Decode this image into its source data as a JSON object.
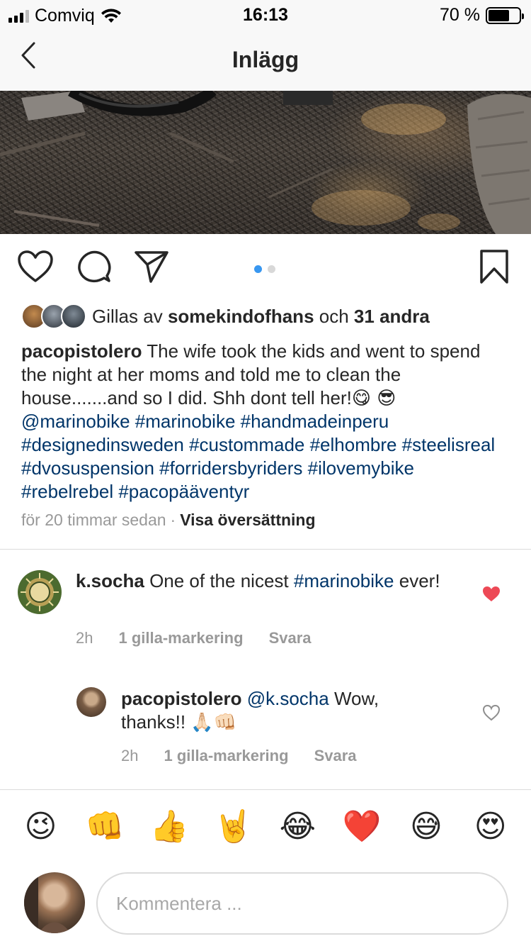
{
  "status_bar": {
    "carrier": "Comviq",
    "time": "16:13",
    "battery": "70 %",
    "battery_level": 0.7
  },
  "nav": {
    "title": "Inlägg",
    "back_icon": "chevron-left-icon"
  },
  "post": {
    "actions": {
      "like_icon": "heart-outline-icon",
      "comment_icon": "comment-bubble-icon",
      "share_icon": "paper-plane-icon",
      "save_icon": "bookmark-icon"
    },
    "carousel": {
      "count": 2,
      "active_index": 0
    },
    "likes": {
      "prefix": "Gillas av",
      "user": "somekindofhans",
      "conjunction": "och",
      "others": "31 andra"
    },
    "caption": {
      "username": "pacopistolero",
      "text": "The wife took the kids and went to spend the night at her moms and told me to clean the house.......and so I did. Shh dont tell her!",
      "emoji": "😋 😎",
      "hashtags": "@marinobike #marinobike #handmadeinperu #designedinsweden #custommade #elhombre #steelisreal #dvosuspension #forridersbyriders #ilovemybike #rebelrebel #pacopääventyr"
    },
    "time_ago": "för 20 timmar sedan",
    "separator": "·",
    "translate_label": "Visa översättning"
  },
  "comments": [
    {
      "username": "k.socha",
      "text_before": "One of the nicest",
      "tag": "#marinobike",
      "text_after": "ever!",
      "time": "2h",
      "likes": "1 gilla-markering",
      "reply": "Svara",
      "liked": true
    },
    {
      "username": "pacopistolero",
      "mention": "@k.socha",
      "text": "Wow, thanks!!",
      "emoji": "🙏🏻👊🏻",
      "time": "2h",
      "likes": "1 gilla-markering",
      "reply": "Svara",
      "liked": false
    }
  ],
  "emoji_bar": [
    "😉",
    "👊",
    "👍",
    "🤘",
    "😂",
    "❤️",
    "😅",
    "😍"
  ],
  "compose": {
    "placeholder": "Kommentera ..."
  },
  "colors": {
    "link": "#003569",
    "meta": "#999999",
    "heart_red": "#ed4956",
    "carousel_active": "#3897f0",
    "divider": "#dbdbdb"
  }
}
